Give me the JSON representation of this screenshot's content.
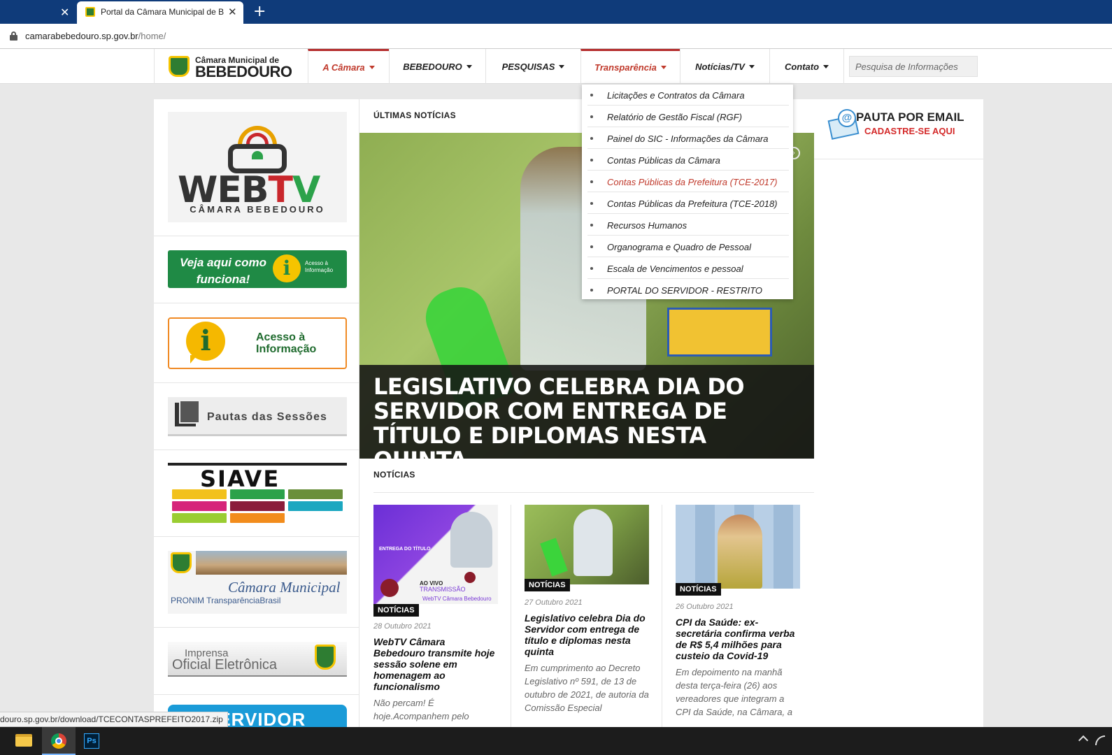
{
  "browser": {
    "active_tab_title": "Portal da Câmara Municipal de Bebedouro",
    "url_host": "camarabebedouro.sp.gov.br",
    "url_path": "/home/",
    "status_url": "douro.sp.gov.br/download/TCECONTASPREFEITO2017.zip"
  },
  "header": {
    "logo_line1": "Câmara Municipal de",
    "logo_line2": "BEBEDOURO",
    "nav": [
      {
        "label": "A Câmara"
      },
      {
        "label": "BEBEDOURO"
      },
      {
        "label": "PESQUISAS"
      },
      {
        "label": "Transparência"
      },
      {
        "label": "Notícias/TV"
      },
      {
        "label": "Contato"
      }
    ],
    "search_placeholder": "Pesquisa de Informações"
  },
  "dropdown": {
    "items": [
      {
        "label": "Licitações e Contratos da Câmara"
      },
      {
        "label": "Relatório de Gestão Fiscal (RGF)"
      },
      {
        "label": "Painel do SIC - Informações da Câmara"
      },
      {
        "label": "Contas Públicas da Câmara"
      },
      {
        "label": "Contas Públicas da Prefeitura (TCE-2017)"
      },
      {
        "label": "Contas Públicas da Prefeitura (TCE-2018)"
      },
      {
        "label": "Recursos Humanos"
      },
      {
        "label": "Organograma e Quadro de Pessoal"
      },
      {
        "label": "Escala de Vencimentos e pessoal"
      },
      {
        "label": "PORTAL DO SERVIDOR - RESTRITO"
      }
    ]
  },
  "sidebar": {
    "webtv_word_a": "WEB",
    "webtv_word_t": "T",
    "webtv_word_v": "V",
    "webtv_sub": "CÂMARA BEBEDOURO",
    "veja_text": "Veja aqui como funciona!",
    "veja_small": "Acesso à Informação",
    "veja_icon": "i",
    "acesso_text": "Acesso à Informação",
    "acesso_icon": "i",
    "pautas_text": "Pautas das Sessões",
    "siave_text": "SIAVE",
    "camara_text": "Câmara Municipal",
    "camara_sub": "PRONIM TransparênciaBrasil",
    "imprensa_1": "Imprensa",
    "imprensa_2": "Oficial Eletrônica",
    "servidor_text": "SERVIDOR"
  },
  "main": {
    "latest_title": "ÚLTIMAS NOTÍCIAS",
    "hero_caption": "LEGISLATIVO CELEBRA DIA DO SERVIDOR COM ENTREGA DE TÍTULO E DIPLOMAS NESTA QUINTA",
    "news_title": "NOTÍCIAS",
    "cards": [
      {
        "badge": "NOTÍCIAS",
        "date": "28 Outubro 2021",
        "title": "WebTV Câmara Bebedouro transmite hoje sessão solene em homenagem ao funcionalismo",
        "excerpt": "Não percam! É hoje.Acompanhem pelo"
      },
      {
        "badge": "NOTÍCIAS",
        "date": "27 Outubro 2021",
        "title": "Legislativo celebra Dia do Servidor com entrega de título e diplomas nesta quinta",
        "excerpt": "Em cumprimento ao Decreto Legislativo nº 591, de 13 de outubro de 2021, de autoria da Comissão Especial"
      },
      {
        "badge": "NOTÍCIAS",
        "date": "26 Outubro 2021",
        "title": "CPI da Saúde: ex-secretária confirma verba de R$ 5,4 milhões para custeio da Covid-19",
        "excerpt": "Em depoimento na manhã desta terça-feira (26) aos vereadores que integram a CPI da Saúde, na Câmara, a"
      }
    ],
    "card1_promo": {
      "line1": "ENTREGA DO TÍTULO",
      "line2": "AO VIVO",
      "line3": "TRANSMISSÃO",
      "line4": "WebTV Câmara Bebedouro"
    }
  },
  "right": {
    "pauta_title": "PAUTA POR EMAIL",
    "pauta_sub": "CADASTRE-SE AQUI"
  }
}
